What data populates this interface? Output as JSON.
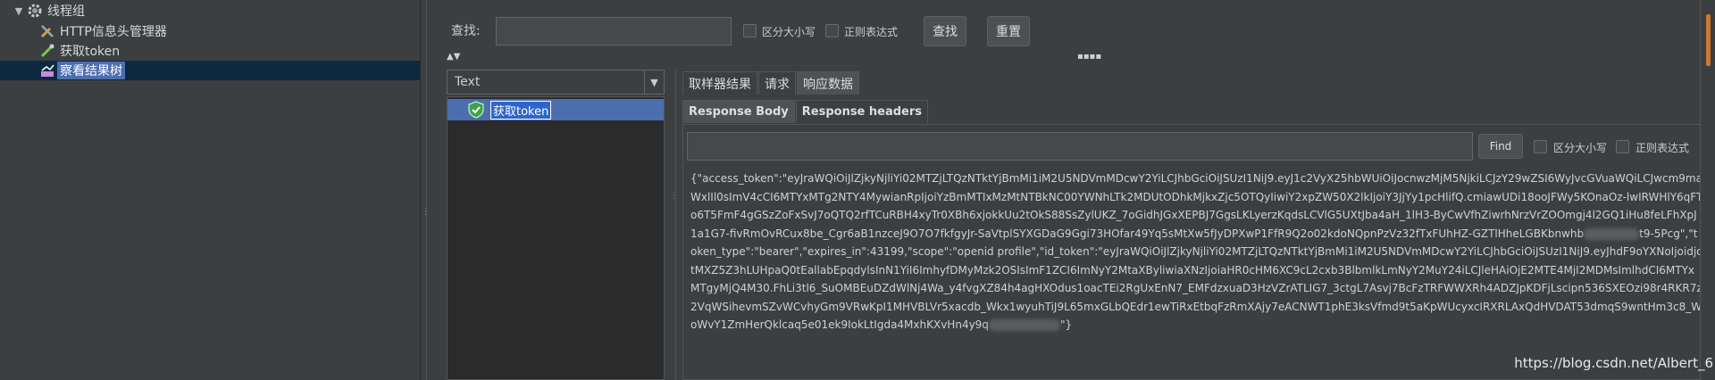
{
  "tree": {
    "items": [
      {
        "label": "线程组",
        "icon": "gear-icon",
        "expanded": true
      },
      {
        "label": "HTTP信息头管理器",
        "icon": "wrench-icon"
      },
      {
        "label": "获取token",
        "icon": "pipette-icon"
      },
      {
        "label": "察看结果树",
        "icon": "chart-icon",
        "selected": true
      }
    ]
  },
  "search": {
    "label": "查找:",
    "value": "",
    "case_sensitive": "区分大小写",
    "regex": "正则表达式",
    "find_button": "查找",
    "reset_button": "重置"
  },
  "renderer": {
    "selected": "Text"
  },
  "results": [
    {
      "label": "获取token",
      "status": "success"
    }
  ],
  "tabs": [
    "取样器结果",
    "请求",
    "响应数据"
  ],
  "active_tab": "响应数据",
  "sub_tabs": [
    "Response Body",
    "Response headers"
  ],
  "active_sub_tab": "Response Body",
  "response_search": {
    "value": "",
    "find_button": "Find",
    "case_sensitive": "区分大小写",
    "regex": "正则表达式"
  },
  "response_body": {
    "part1": "{\"access_token\":\"eyJraWQiOiJlZjkyNjliYi02MTZjLTQzNTktYjBmMi1iM2U5NDVmMDcwY2YiLCJhbGciOiJSUzI1NiJ9.eyJ1c2VyX25hbWUiOiJocnwzMjM5NjkiLCJzY29wZSI6WyJvcGVuaWQiLCJwcm9maWxlIl0sImV4cCI6MTYxMTg2NTY4MywianRpIjoiYzBmMTIxMzMtNTBkNC00YWNhLTk2MDUtODhkMjkxZjc5OTQyIiwiY2xpZW50X2lkIjoiY3JjYy1pcHlifQ.cmiawUDi18ooJFWy5KOnaOz-lwIRWHlY6qFTo6T5FmF4gGSzZoFxSvJ7oQTQ2rfTCuRBH4xyTr0XBh6xjokkUu2tOkS88SsZylUKZ_7oGidhJGxXEPBJ7GgsLKLyerzKqdsLCVlG5UXtJba4aH_1lH3-ByCwVfhZiwrhNrzVrZOOmgj4l2GQ1iHu8feLFhXpJ1a1G7-fivRmOvRCux8be_Cgr6aB1nzceJ9O7O7fkfgyJr-SaVtplSYXGDaG9Ggi73HOfar49Yq5sMtXw5fJyDPXwP1FfR9Q2o02kdoNQpnPzVz32fTxFUhHZ-GZTlHheLGBKbnwhb",
    "part2": "t9-5Pcg\",\"token_type\":\"bearer\",\"expires_in\":43199,\"scope\":\"openid profile\",\"id_token\":\"eyJraWQiOiJlZjkyNjliYi02MTZjLTQzNTktYjBmMi1iM2U5NDVmMDcwY2YiLCJhbGciOiJSUzI1NiJ9.eyJhdF9oYXNoIjoidjctMXZ5Z3hLUHpaQ0tEallabEpqdylsInN1YiI6ImhyfDMyMzk2OSIsImF1ZCI6ImNyY2MtaXByliwiaXNzIjoiaHR0cHM6XC9cL2cxb3BlbmlkLmNyY2MuY24iLCJleHAiOjE2MTE4MjI2MDMsImlhdCI6MTYxMTgyMjQ4M30.FhLi3tl6_SuOMBEuDZdWlNj4Wa_y4fvgXZ84h4agHXOdus1oacTEi2RgUxEnN7_EMFdzxuaD3HzVZrATLIG7_3ctgL7Asvj7BcFzTRFWWXRh4ADZJpKDFjLscipn536SXEOzi98r4RKR7z2VqWSihevmSZvWCvhyGm9VRwKpI1MHVBLVr5xacdb_Wkx1wyuhTiJ9L65mxGLbQEdr1ewTiRxEtbqFzRmXAjy7eACNWT1phE3ksVfmd9t5aKpWUcyxcIRXRLAxQdHVDAT53dmqS9wntHm3c8_WoWvY1ZmHerQklcaq5e01ek9IokLtIgda4MxhKXvHn4y9q",
    "part3": "\"}"
  },
  "watermark": "https://blog.csdn.net/Albert_6"
}
